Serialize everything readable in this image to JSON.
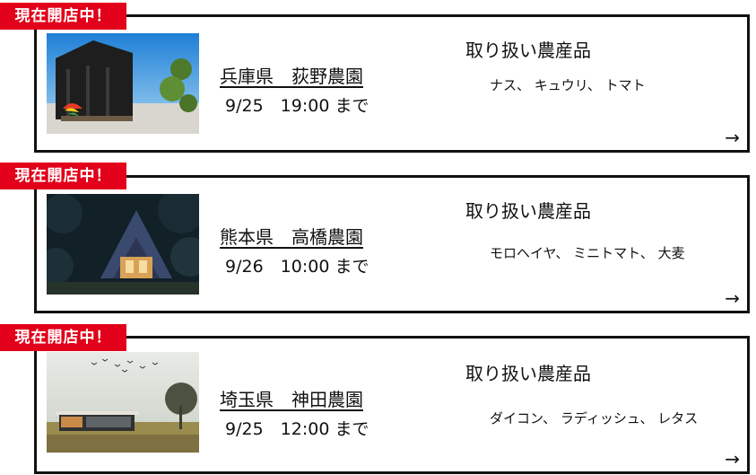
{
  "farms": [
    {
      "badge": "現在開店中！",
      "name": "兵庫県　荻野農園",
      "deadline": "9/25　19:00 まで",
      "produce_heading": "取り扱い農産品",
      "produce": "ナス、 キュウリ、 トマト",
      "arrow": "→"
    },
    {
      "badge": "現在開店中！",
      "name": "熊本県　高橋農園",
      "deadline": "9/26　10:00 まで",
      "produce_heading": "取り扱い農産品",
      "produce": "モロヘイヤ、 ミニトマト、 大麦",
      "arrow": "→"
    },
    {
      "badge": "現在開店中！",
      "name": "埼玉県　神田農園",
      "deadline": "9/25　12:00 まで",
      "produce_heading": "取り扱い農産品",
      "produce": "ダイコン、 ラディッシュ、 レタス",
      "arrow": "→"
    }
  ],
  "colors": {
    "badge_bg": "#e2001a",
    "border": "#111111"
  }
}
